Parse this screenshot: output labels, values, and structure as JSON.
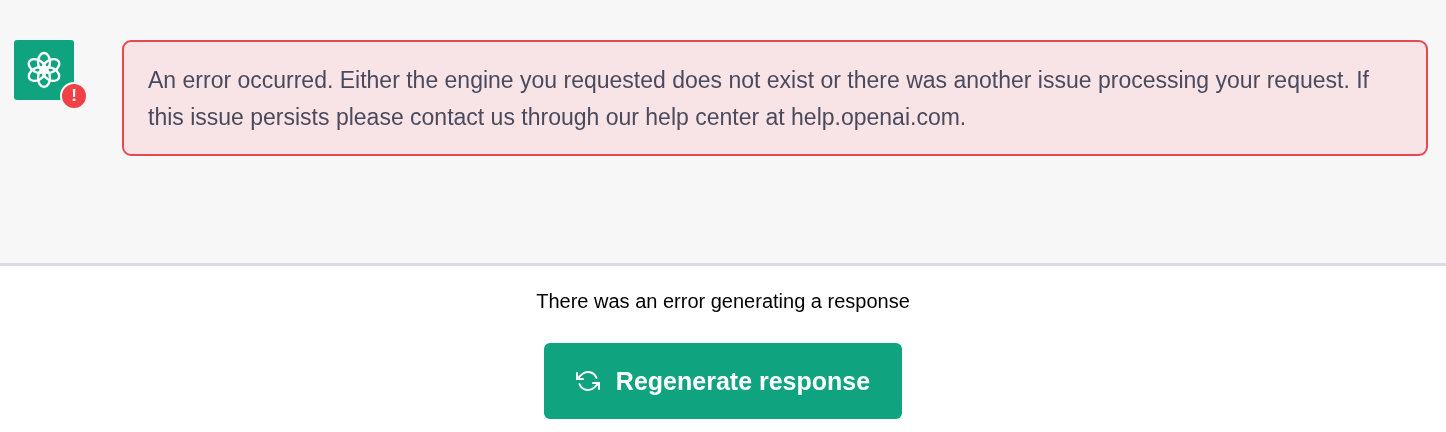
{
  "message": {
    "badge": "!",
    "error_text": "An error occurred. Either the engine you requested does not exist or there was another issue processing your request. If this issue persists please contact us through our help center at help.openai.com."
  },
  "footer": {
    "notice": "There was an error generating a response",
    "button": "Regenerate response"
  }
}
